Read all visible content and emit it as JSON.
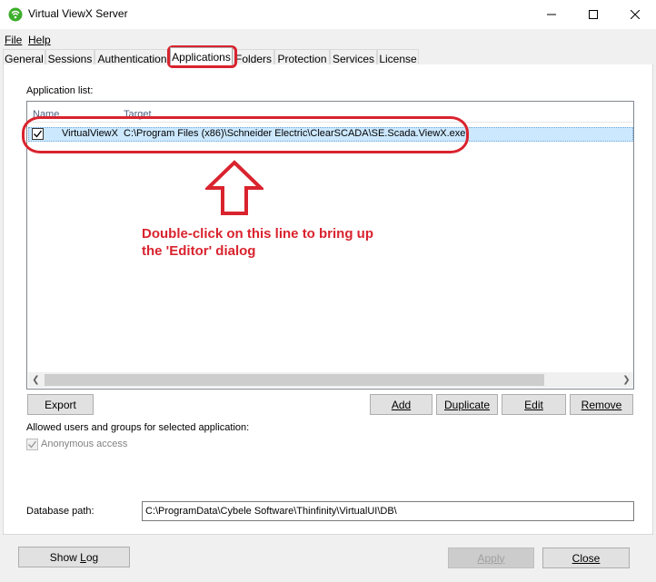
{
  "window": {
    "title": "Virtual ViewX Server",
    "icon": "wifi-broadcast-icon"
  },
  "menu": {
    "file": "File",
    "help": "Help"
  },
  "tabs": [
    "General",
    "Sessions",
    "Authentication",
    "Applications",
    "Folders",
    "Protection",
    "Services",
    "License"
  ],
  "active_tab": "Applications",
  "applications": {
    "list_label": "Application list:",
    "columns": [
      "Name",
      "Target"
    ],
    "rows": [
      {
        "checked": true,
        "name": "VirtualViewX",
        "target": "C:\\Program Files (x86)\\Schneider Electric\\ClearSCADA\\SE.Scada.ViewX.exe"
      }
    ],
    "buttons": {
      "export": "Export",
      "add": "Add",
      "duplicate": "Duplicate",
      "edit": "Edit",
      "remove": "Remove"
    },
    "allowed_label": "Allowed users and groups for selected application:",
    "anonymous_access": {
      "label": "Anonymous access",
      "checked": true,
      "enabled": false
    }
  },
  "database": {
    "label": "Database path:",
    "value": "C:\\ProgramData\\Cybele Software\\Thinfinity\\VirtualUI\\DB\\"
  },
  "footer": {
    "show_log": "Show Log",
    "apply": "Apply",
    "close": "Close"
  },
  "annotation": {
    "text_line1": "Double-click on this line to bring up",
    "text_line2": "the 'Editor' dialog",
    "color": "#d9232e"
  },
  "colors": {
    "selection": "#cce8ff",
    "window_bg": "#f0f0f0"
  }
}
